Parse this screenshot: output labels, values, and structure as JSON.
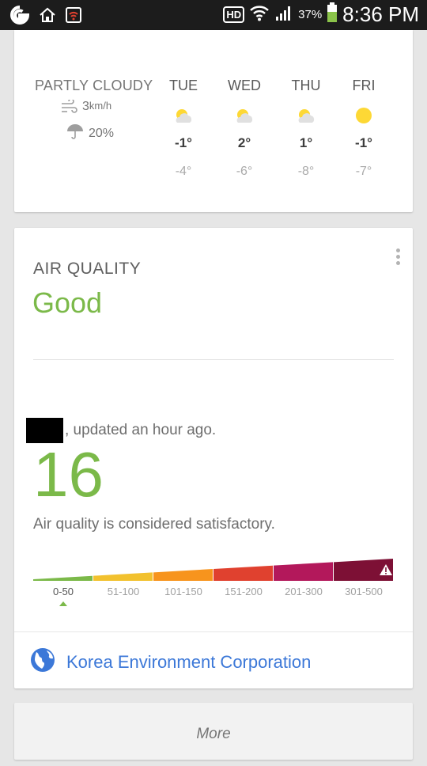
{
  "status_bar": {
    "hd_label": "HD",
    "battery_percent": "37%",
    "time": "8:36 PM"
  },
  "weather": {
    "condition": "PARTLY CLOUDY",
    "wind_value": "3",
    "wind_unit": "km/h",
    "precip": "20%",
    "days": [
      {
        "name": "TUE",
        "icon": "partly-cloudy-icon",
        "hi": "-1°",
        "lo": "-4°"
      },
      {
        "name": "WED",
        "icon": "partly-cloudy-icon",
        "hi": "2°",
        "lo": "-6°"
      },
      {
        "name": "THU",
        "icon": "partly-cloudy-icon",
        "hi": "1°",
        "lo": "-8°"
      },
      {
        "name": "FRI",
        "icon": "sun-icon",
        "hi": "-1°",
        "lo": "-7°"
      }
    ]
  },
  "air_quality": {
    "title": "AIR QUALITY",
    "status": "Good",
    "status_color": "#7bb949",
    "update_text": ", updated an hour ago.",
    "value": "16",
    "description": "Air quality is considered satisfactory.",
    "scale": [
      {
        "label": "0-50",
        "color": "#7bb949"
      },
      {
        "label": "51-100",
        "color": "#f2c12e"
      },
      {
        "label": "101-150",
        "color": "#f7941d"
      },
      {
        "label": "151-200",
        "color": "#e0412f"
      },
      {
        "label": "201-300",
        "color": "#b3185b"
      },
      {
        "label": "301-500",
        "color": "#7d1035"
      }
    ],
    "active_range": "0-50",
    "source": "Korea Environment Corporation"
  },
  "more": {
    "label": "More"
  }
}
